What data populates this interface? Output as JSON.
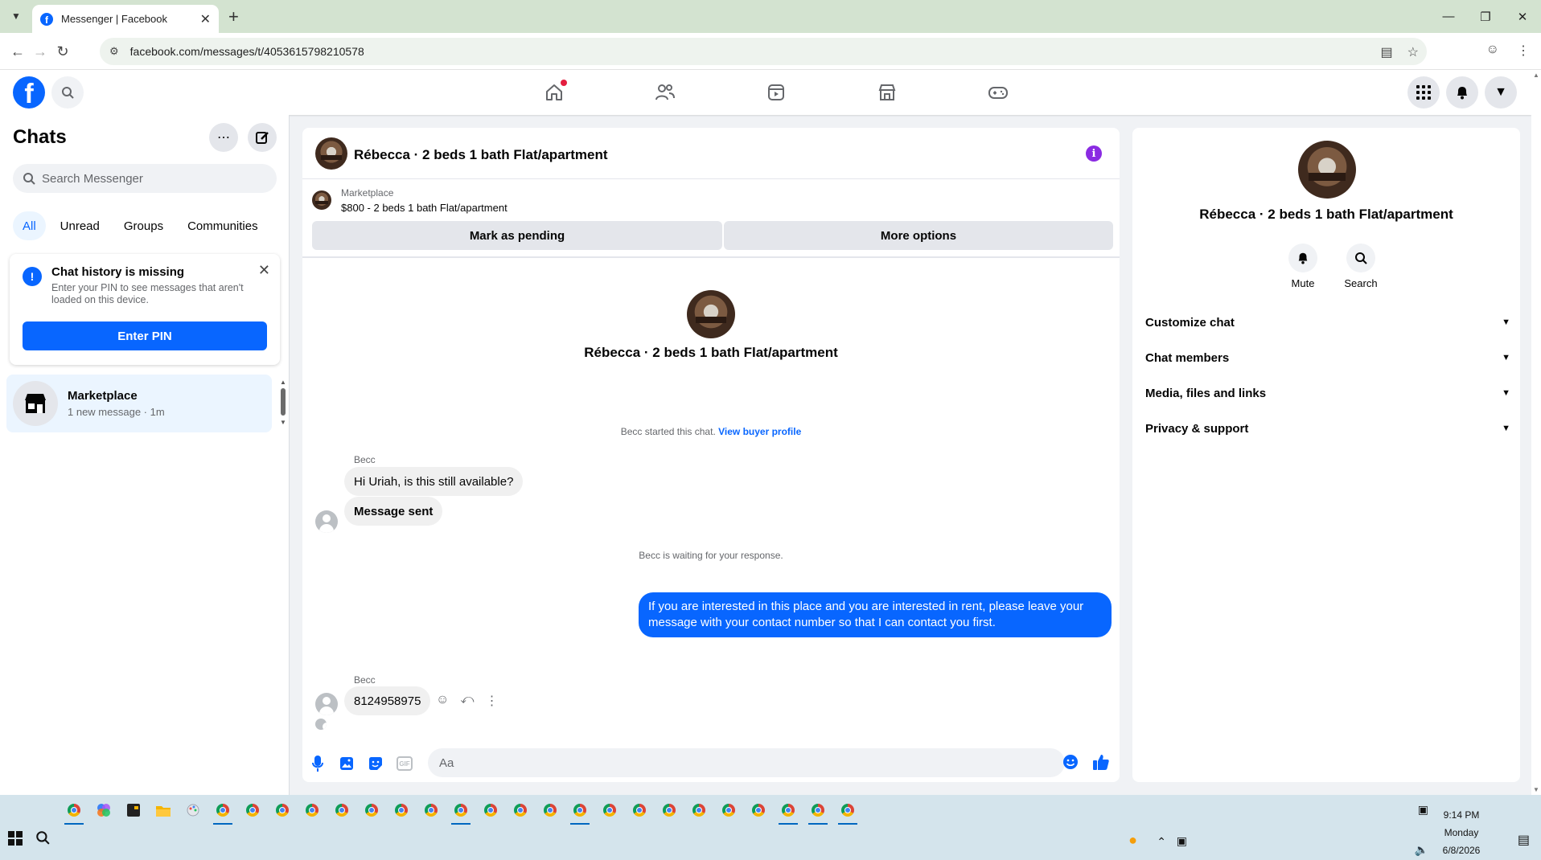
{
  "browser": {
    "tab_title": "Messenger | Facebook",
    "url": "facebook.com/messages/t/4053615798210578"
  },
  "sidebar": {
    "title": "Chats",
    "search_placeholder": "Search Messenger",
    "filters": [
      "All",
      "Unread",
      "Groups",
      "Communities"
    ],
    "pin_card": {
      "title": "Chat history is missing",
      "text": "Enter your PIN to see messages that aren't loaded on this device.",
      "button": "Enter PIN"
    },
    "chats": [
      {
        "name": "Marketplace",
        "subtitle": "1 new message · 1m"
      }
    ]
  },
  "conversation": {
    "title": "Rébecca · 2 beds 1 bath Flat/apartment",
    "marketplace_label": "Marketplace",
    "listing": "$800 - 2 beds 1 bath Flat/apartment",
    "mark_pending": "Mark as pending",
    "more_options": "More options",
    "started_text": "Becc started this chat.",
    "view_profile": "View buyer profile",
    "messages": [
      {
        "sender": "Becc",
        "text": "Hi Uriah, is this still available?"
      },
      {
        "text": "Message sent"
      }
    ],
    "waiting_text": "Becc is waiting for your response.",
    "outgoing": "If you are interested in this place and you are interested in rent, please leave your message with your contact number so that I can contact you first.",
    "last_sender": "Becc",
    "last_message": "8124958975",
    "composer_placeholder": "Aa",
    "gif_label": "GIF"
  },
  "info_pane": {
    "name": "Rébecca · 2 beds 1 bath Flat/apartment",
    "actions": [
      "Mute",
      "Search"
    ],
    "sections": [
      "Customize chat",
      "Chat members",
      "Media, files and links",
      "Privacy & support"
    ]
  },
  "taskbar": {
    "time": "9:14 PM",
    "day": "Monday",
    "date": "6/8/2026"
  },
  "colors": {
    "accent": "#0866ff",
    "bubble_out": "#0866ff",
    "info_icon": "#8a2be2"
  }
}
